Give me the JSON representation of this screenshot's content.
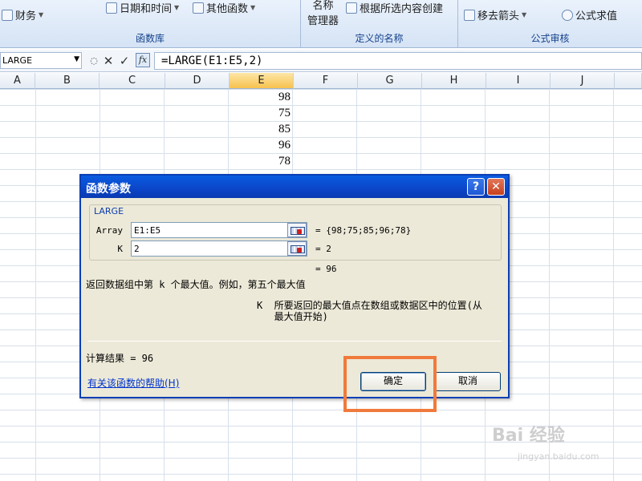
{
  "ribbon": {
    "finance_label": "财务",
    "datetime_label": "日期和时间",
    "other_functions_label": "其他函数",
    "name_manager_label_top": "名称",
    "name_manager_label": "管理器",
    "create_from_selection_label": "根据所选内容创建",
    "remove_arrows_label": "移去箭头",
    "evaluate_formula_label": "公式求值",
    "group_function_library": "函数库",
    "group_defined_names": "定义的名称",
    "group_formula_auditing": "公式审核"
  },
  "formula_bar": {
    "name_box": "LARGE",
    "cancel_icon": "✕",
    "enter_icon": "✓",
    "fx_label": "fx",
    "formula": "=LARGE(E1:E5,2)"
  },
  "columns": [
    "A",
    "B",
    "C",
    "D",
    "E",
    "F",
    "G",
    "H",
    "I",
    "J"
  ],
  "selected_column": "E",
  "cells_e": [
    "98",
    "75",
    "85",
    "96",
    "78"
  ],
  "dialog": {
    "title": "函数参数",
    "help_button": "?",
    "close_button": "✕",
    "function_name": "LARGE",
    "args": [
      {
        "label": "Array",
        "value": "E1:E5",
        "result": "= {98;75;85;96;78}"
      },
      {
        "label": "K",
        "value": "2",
        "result": "= 2"
      }
    ],
    "formula_result": "= 96",
    "description": "返回数据组中第 k 个最大值。例如，第五个最大值",
    "arg_help_line1": "K  所要返回的最大值点在数组或数据区中的位置(从",
    "arg_help_line2": "   最大值开始)",
    "calc_result": "计算结果 = 96",
    "help_link": "有关该函数的帮助(H)",
    "ok_button": "确定",
    "cancel_button": "取消"
  },
  "watermark": {
    "text": "Bai 经验",
    "sub": "jingyan.baidu.com"
  },
  "colors": {
    "title_bar": "#0b45c8",
    "selected_header": "#f7c24e",
    "highlight_box": "#f07a3c"
  }
}
